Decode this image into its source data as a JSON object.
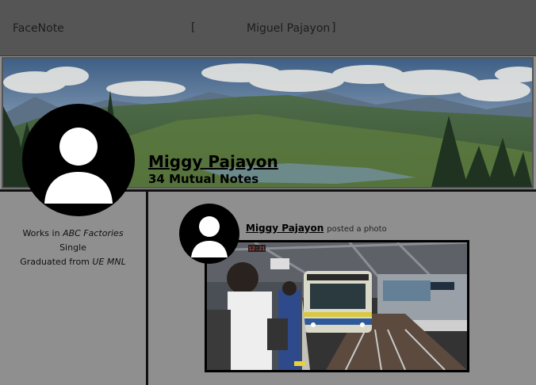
{
  "topbar": {
    "brand": "FaceNote",
    "bracket_left": "[",
    "user_name": "Miguel Pajayon",
    "bracket_right": "]"
  },
  "profile": {
    "name": "Miggy Pajayon",
    "mutual_notes": "34 Mutual Notes"
  },
  "about": {
    "works_prefix": "Works in ",
    "works_place": "ABC Factories",
    "status": "Single",
    "grad_prefix": "Graduated from ",
    "grad_school": "UE MNL"
  },
  "post": {
    "author": "Miggy Pajayon",
    "action": "posted a photo",
    "station_clock": "12:21"
  },
  "colors": {
    "topbar": "#555555",
    "page_bg": "#8f8f8f",
    "dividers": "#111111"
  }
}
